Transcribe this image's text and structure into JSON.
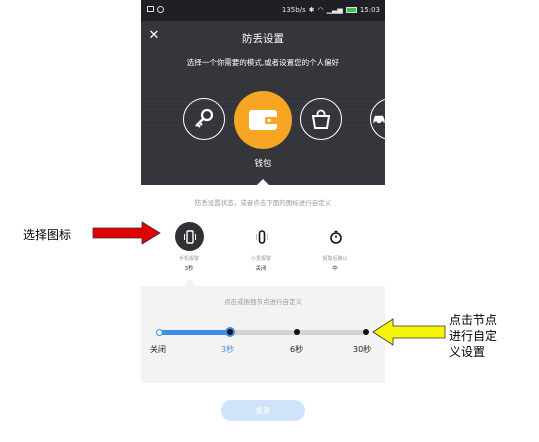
{
  "status_bar": {
    "speed": "135b/s",
    "time": "15:03"
  },
  "header": {
    "title": "防丢设置",
    "subtitle": "选择一个你需要的模式,或者设置您的个人偏好"
  },
  "modes": {
    "selected_label": "钱包"
  },
  "alarm_section": {
    "hint": "防丢设置状态，或者点击下面的图标进行自定义",
    "options": [
      {
        "title": "手机报警",
        "value": "3秒",
        "icon": "phone-vibrate-icon"
      },
      {
        "title": "小觅报警",
        "value": "关闭",
        "icon": "tag-vibrate-icon"
      },
      {
        "title": "报警后确认",
        "value": "中",
        "icon": "stopwatch-icon"
      }
    ]
  },
  "slider": {
    "hint": "点击或拖拽节点进行自定义",
    "ticks": [
      "关闭",
      "3秒",
      "6秒",
      "30秒"
    ],
    "selected": "3秒",
    "selected_index": 1
  },
  "reset_button": {
    "label": "重置"
  },
  "annotations": {
    "left": "选择图标",
    "right_line1": "点击节点",
    "right_line2": "进行自定",
    "right_line3": "义设置"
  },
  "colors": {
    "accent": "#3d8fe6",
    "wallet": "#f6a623",
    "arrow_left": "#e00000",
    "arrow_right": "#f5f50a"
  }
}
